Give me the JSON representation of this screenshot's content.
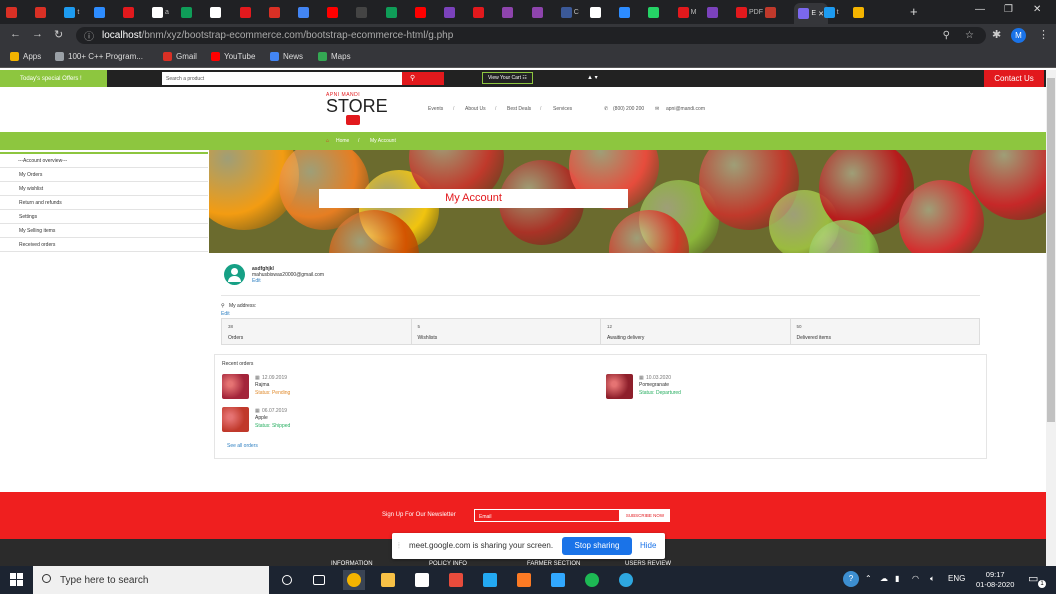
{
  "browser": {
    "tabs": [
      {
        "label": "",
        "color": "#d93025"
      },
      {
        "label": "",
        "color": "#d93025"
      },
      {
        "label": "t",
        "color": "#1d9bf0"
      },
      {
        "label": "",
        "color": "#2d8cff"
      },
      {
        "label": "",
        "color": "#e2191d"
      },
      {
        "label": "a",
        "color": "#ffffff"
      },
      {
        "label": "",
        "color": "#0f9d58"
      },
      {
        "label": "",
        "color": "#ffffff"
      },
      {
        "label": "",
        "color": "#e2191d"
      },
      {
        "label": "",
        "color": "#d93025"
      },
      {
        "label": "",
        "color": "#4285f4"
      },
      {
        "label": "",
        "color": "#ff0000"
      },
      {
        "label": "",
        "color": "#444444"
      },
      {
        "label": "",
        "color": "#0f9d58"
      },
      {
        "label": "",
        "color": "#ff0000"
      },
      {
        "label": "",
        "color": "#7b42bc"
      },
      {
        "label": "",
        "color": "#e2191d"
      },
      {
        "label": "",
        "color": "#8e44ad"
      },
      {
        "label": "",
        "color": "#8e44ad"
      },
      {
        "label": "C",
        "color": "#3b5998"
      },
      {
        "label": "",
        "color": "#ffffff"
      },
      {
        "label": "",
        "color": "#2d8cff"
      },
      {
        "label": "",
        "color": "#25d366"
      },
      {
        "label": "M",
        "color": "#e2191d"
      },
      {
        "label": "",
        "color": "#7b42bc"
      },
      {
        "label": "PDF",
        "color": "#e2191d"
      },
      {
        "label": "",
        "color": "#c0392b"
      },
      {
        "label": "E",
        "color": "#7b68ee"
      },
      {
        "label": "t",
        "color": "#1d9bf0"
      },
      {
        "label": "",
        "color": "#f4b400"
      }
    ],
    "url_host": "localhost",
    "url_path": "/bnm/xyz/bootstrap-ecommerce.com/bootstrap-ecommerce-html/g.php",
    "profile_initial": "M",
    "bookmarks": [
      {
        "label": "Apps",
        "color": "#f4b400"
      },
      {
        "label": "100+ C++ Program...",
        "color": "#9aa0a6"
      },
      {
        "label": "Gmail",
        "color": "#d93025"
      },
      {
        "label": "YouTube",
        "color": "#ff0000"
      },
      {
        "label": "News",
        "color": "#4285f4"
      },
      {
        "label": "Maps",
        "color": "#34a853"
      }
    ]
  },
  "site": {
    "offer": "Today's special Offers !",
    "search_placeholder": "Search a product",
    "search_btn": "⚲",
    "cart": "View Your Cart ☷",
    "user": "▲ ▾",
    "contact": "Contact Us",
    "logo_small": "APNI MANDI",
    "logo_big": "STORE",
    "nav": [
      "Events",
      "About Us",
      "Best Deals",
      "Services"
    ],
    "phone": "(800) 200 200",
    "email": "apni@mandi.com",
    "breadcrumb_home": "Home",
    "breadcrumb_current": "My Account",
    "sidebar": [
      "---Account overview---",
      "My Orders",
      "My wishlist",
      "Return and refunds",
      "Settings",
      "My Selling items",
      "Received orders"
    ],
    "hero_title": "My Account",
    "profile": {
      "name": "asdfghjkl",
      "email": "mahusbiswas20000@gmail.com",
      "edit": "Edit"
    },
    "address": {
      "label": "My address:",
      "edit": "Edit"
    },
    "stats": [
      {
        "value": "38",
        "label": "Orders"
      },
      {
        "value": "5",
        "label": "Wishlists"
      },
      {
        "value": "12",
        "label": "Awaiting delivery"
      },
      {
        "value": "50",
        "label": "Delivered items"
      }
    ],
    "recent_title": "Recent orders",
    "orders": [
      {
        "date": "12.09.2019",
        "name": "Rajma",
        "status": "Status: Pending",
        "status_color": "#e08a2b",
        "img": "#a3243a"
      },
      {
        "date": "10.03.2020",
        "name": "Pomegranate",
        "status": "Status: Departured",
        "status_color": "#27ae60",
        "img": "#8e1f2b"
      },
      {
        "date": "06.07.2019",
        "name": "Apple",
        "status": "Status: Shipped",
        "status_color": "#27ae60",
        "img": "#c0392b"
      }
    ],
    "see_all": "See all orders",
    "newsletter_label": "Sign Up For Our Newsletter",
    "newsletter_placeholder": "Email",
    "subscribe": "SUBSCRIBE NOW",
    "footer_heads": [
      "INFORMATION",
      "POLICY INFO",
      "FARMER SECTION",
      "USERS REVIEW"
    ]
  },
  "share_bar": {
    "message": "meet.google.com is sharing your screen.",
    "stop": "Stop sharing",
    "hide": "Hide"
  },
  "taskbar": {
    "search": "Type here to search",
    "lang": "ENG",
    "time": "09:17",
    "date": "01-08-2020",
    "notif": "1",
    "apps": [
      {
        "name": "task-view",
        "color": "#ffffff"
      },
      {
        "name": "chrome",
        "color": "#f4b400"
      },
      {
        "name": "file-explorer",
        "color": "#f8c146"
      },
      {
        "name": "store",
        "color": "#ffffff"
      },
      {
        "name": "office",
        "color": "#e74c3c"
      },
      {
        "name": "vscode",
        "color": "#23a9f2"
      },
      {
        "name": "xampp",
        "color": "#fb7a24"
      },
      {
        "name": "photoshop",
        "color": "#31a8ff"
      },
      {
        "name": "spotify",
        "color": "#1db954"
      },
      {
        "name": "edge",
        "color": "#2ea7e0"
      }
    ]
  }
}
